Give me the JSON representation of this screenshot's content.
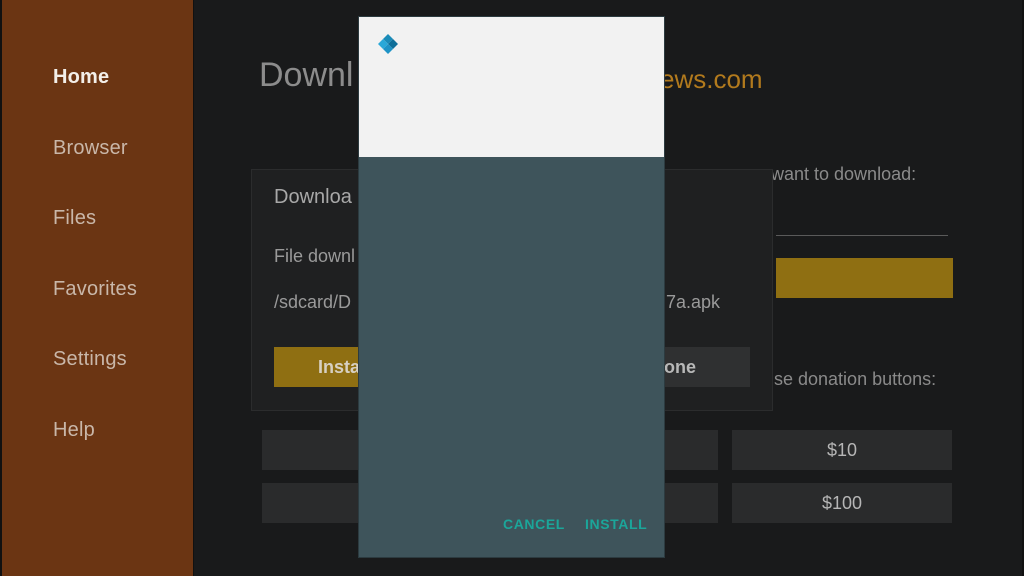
{
  "sidebar": {
    "items": [
      {
        "label": "Home",
        "active": true
      },
      {
        "label": "Browser",
        "active": false
      },
      {
        "label": "Files",
        "active": false
      },
      {
        "label": "Favorites",
        "active": false
      },
      {
        "label": "Settings",
        "active": false
      },
      {
        "label": "Help",
        "active": false
      }
    ]
  },
  "main": {
    "title_partial": "Downl",
    "title_domain_partial": "ews.com",
    "url_prompt_partial": "want to download:",
    "donation_prompt_partial": "se donation buttons:",
    "donation_buttons": [
      "$10",
      "$100"
    ]
  },
  "download_card": {
    "title_partial": "Downloa",
    "status_partial": "File downl",
    "path_left_partial": "/sdcard/D",
    "path_right_partial": "7a.apk",
    "install_label_partial": "Insta",
    "done_label_partial": "one"
  },
  "modal": {
    "cancel_label": "CANCEL",
    "install_label": "INSTALL"
  },
  "colors": {
    "sidebar_bg": "#6b3513",
    "accent_gold": "#8f6f12",
    "modal_body": "#3e545b",
    "modal_action": "#1ba69a"
  }
}
